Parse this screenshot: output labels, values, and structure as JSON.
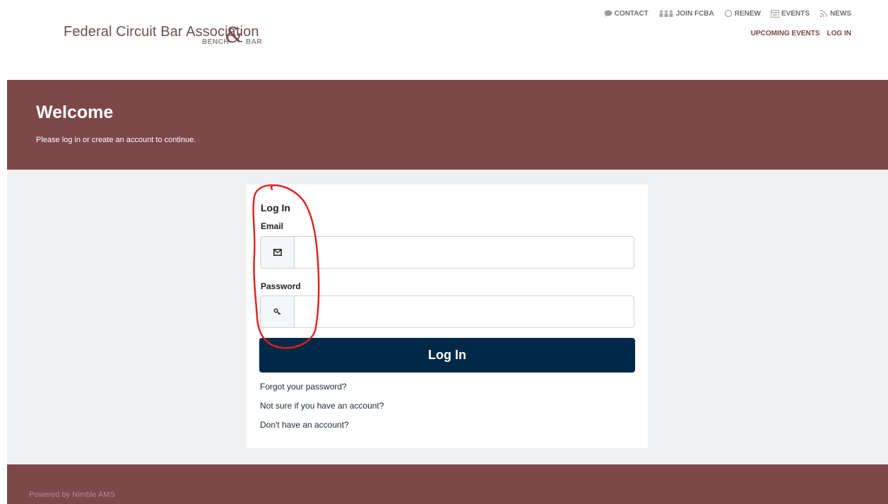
{
  "logo": {
    "name": "Federal Circuit Bar Association",
    "ampersand": "&",
    "bench": "BENCH",
    "bar": "BAR"
  },
  "topnav": {
    "items": [
      {
        "label": "CONTACT",
        "icon": "chat-bubble-icon"
      },
      {
        "label": "JOIN FCBA",
        "icon": "people-icon"
      },
      {
        "label": "RENEW",
        "icon": "refresh-circle-icon"
      },
      {
        "label": "EVENTS",
        "icon": "calendar-icon"
      },
      {
        "label": "NEWS",
        "icon": "rss-icon"
      }
    ],
    "secondary": [
      {
        "label": "UPCOMING EVENTS"
      },
      {
        "label": "LOG IN"
      }
    ]
  },
  "hero": {
    "title": "Welcome",
    "subtitle": "Please log in or create an account to continue."
  },
  "login": {
    "title": "Log In",
    "email_label": "Email",
    "email_value": "",
    "email_placeholder": "",
    "email_icon": "envelope-icon",
    "password_label": "Password",
    "password_value": "",
    "password_placeholder": "",
    "password_icon": "key-icon",
    "button_label": "Log In",
    "links": [
      {
        "label": "Forgot your password?"
      },
      {
        "label": "Not sure if you have an account?"
      },
      {
        "label": "Don't have an account?"
      }
    ]
  },
  "footer": {
    "text": "Powered by Nimble AMS"
  },
  "colors": {
    "brand_maroon": "#7e474a",
    "button_navy": "#002947",
    "annotation_red": "#e0201c"
  }
}
